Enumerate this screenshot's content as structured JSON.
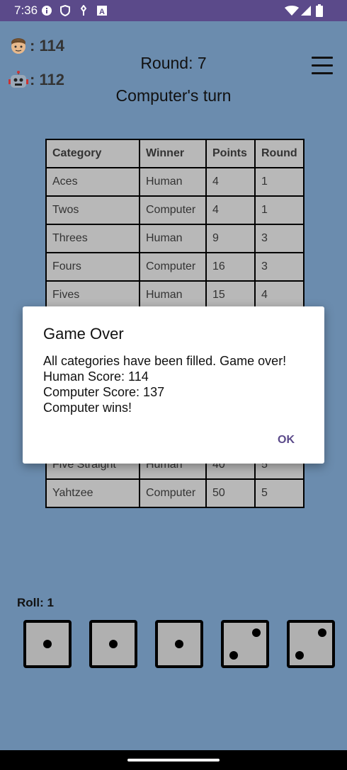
{
  "status_bar": {
    "time": "7:36",
    "icons": [
      "info-icon",
      "shield-icon",
      "usb-icon",
      "a-badge-icon",
      "wifi-icon",
      "signal-icon",
      "battery-icon"
    ]
  },
  "scores": {
    "human": {
      "icon": "human-face-icon",
      "label": ": 114"
    },
    "computer": {
      "icon": "robot-face-icon",
      "label": ": 112"
    }
  },
  "header": {
    "round": "Round: 7",
    "turn": "Computer's turn",
    "menu_icon": "hamburger-menu-icon"
  },
  "table": {
    "headers": [
      "Category",
      "Winner",
      "Points",
      "Round"
    ],
    "rows": [
      [
        "Aces",
        "Human",
        "4",
        "1"
      ],
      [
        "Twos",
        "Computer",
        "4",
        "1"
      ],
      [
        "Threes",
        "Human",
        "9",
        "3"
      ],
      [
        "Fours",
        "Computer",
        "16",
        "3"
      ],
      [
        "Fives",
        "Human",
        "15",
        "4"
      ],
      [
        "",
        "",
        "",
        ""
      ],
      [
        "",
        "",
        "",
        ""
      ],
      [
        "",
        "",
        "",
        ""
      ],
      [
        "",
        "",
        "",
        ""
      ],
      [
        "",
        "",
        "",
        ""
      ],
      [
        "Five Straight",
        "Human",
        "40",
        "5"
      ],
      [
        "Yahtzee",
        "Computer",
        "50",
        "5"
      ]
    ]
  },
  "dialog": {
    "title": "Game Over",
    "lines": [
      "All categories have been filled. Game over!",
      "Human Score: 114",
      "Computer Score: 137",
      "Computer wins!"
    ],
    "ok_label": "OK",
    "ok_color": "#5b4a8a"
  },
  "dice": {
    "roll_label": "Roll: 1",
    "values": [
      1,
      1,
      1,
      2,
      2
    ]
  },
  "colors": {
    "background": "#6b8cae",
    "status_bar": "#5b4a8a"
  }
}
